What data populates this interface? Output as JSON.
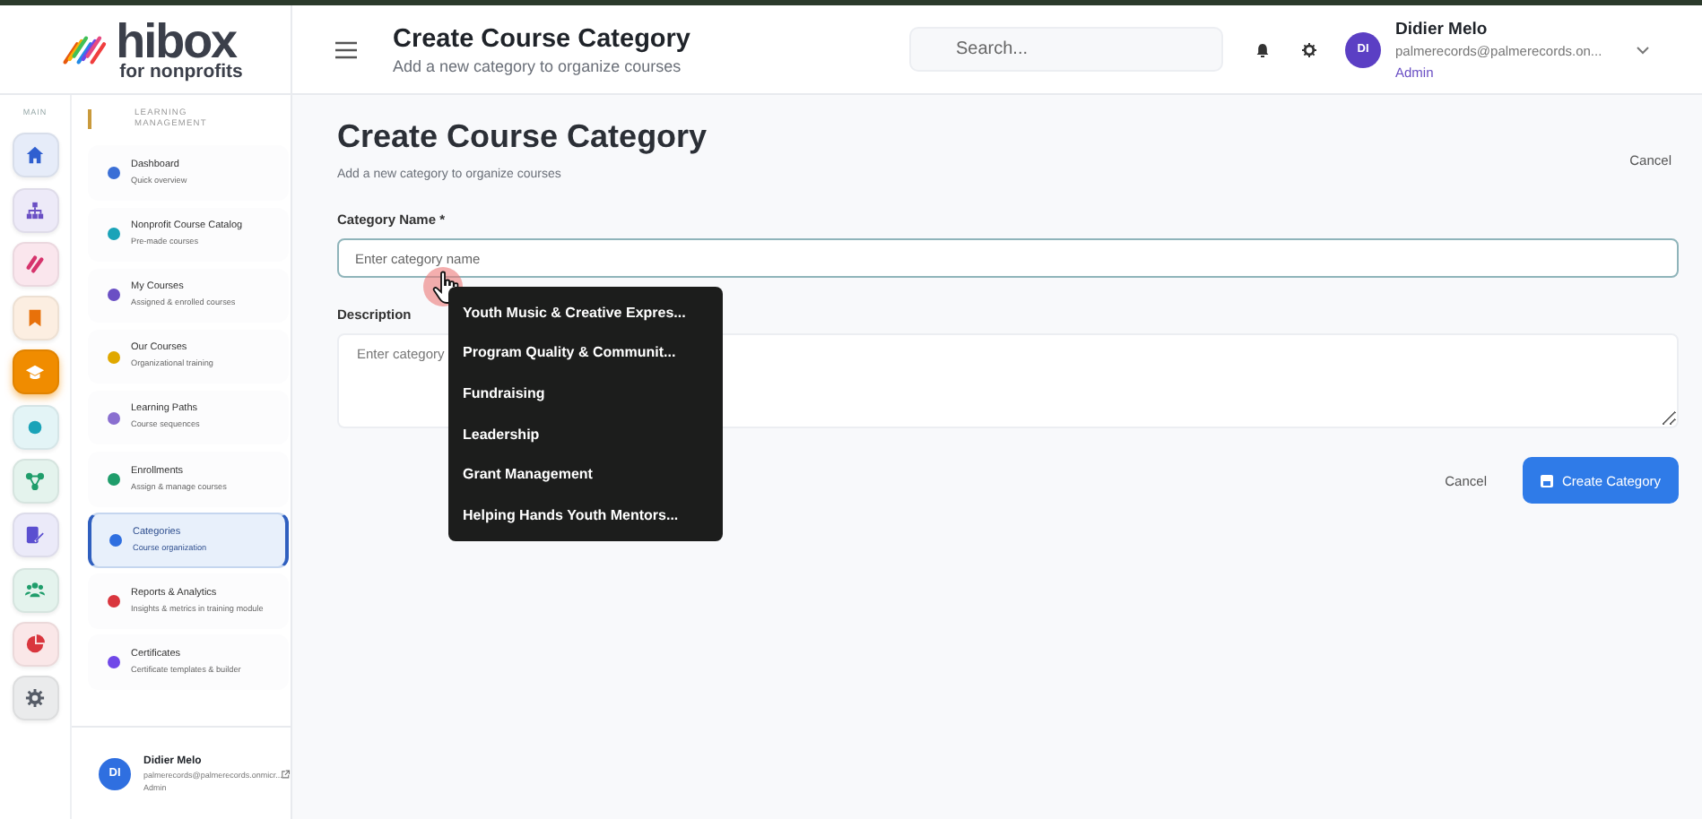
{
  "logo": {
    "name": "hibox",
    "tagline": "for nonprofits"
  },
  "header": {
    "title": "Create Course Category",
    "subtitle": "Add a new category to organize courses",
    "search": {
      "placeholder": "Search..."
    },
    "user": {
      "avatar": "DI",
      "name": "Didier Melo",
      "email": "palmerecords@palmerecords.on...",
      "role": "Admin"
    }
  },
  "rail": {
    "label": "MAIN",
    "items": [
      {
        "kind": "home",
        "color": "#2f5fd0",
        "selected": false
      },
      {
        "kind": "sitemap",
        "color": "#6a4fc4",
        "selected": false
      },
      {
        "kind": "link",
        "color": "#d6336c",
        "selected": false
      },
      {
        "kind": "bookmark",
        "color": "#e8710a",
        "selected": false
      },
      {
        "kind": "cap",
        "color": "#f08c00",
        "selected": true
      },
      {
        "kind": "dot",
        "color": "#1aa3b8",
        "selected": false
      },
      {
        "kind": "share",
        "color": "#1f9d6b",
        "selected": false
      },
      {
        "kind": "edit",
        "color": "#5b4fd0",
        "selected": false
      },
      {
        "kind": "people",
        "color": "#1f9d6b",
        "selected": false
      },
      {
        "kind": "pie",
        "color": "#d9363e",
        "selected": false
      },
      {
        "kind": "gear",
        "color": "#555b66",
        "selected": false
      }
    ]
  },
  "nav": {
    "heading": "LEARNING MANAGEMENT",
    "items": [
      {
        "title": "Dashboard",
        "subtitle": "Quick overview",
        "color": "#3b6fd6",
        "selected": false
      },
      {
        "title": "Nonprofit Course Catalog",
        "subtitle": "Pre-made courses",
        "color": "#1aa3b8",
        "selected": false
      },
      {
        "title": "My Courses",
        "subtitle": "Assigned & enrolled courses",
        "color": "#6a4fc4",
        "selected": false
      },
      {
        "title": "Our Courses",
        "subtitle": "Organizational training",
        "color": "#e0a800",
        "selected": false
      },
      {
        "title": "Learning Paths",
        "subtitle": "Course sequences",
        "color": "#8a6fd0",
        "selected": false
      },
      {
        "title": "Enrollments",
        "subtitle": "Assign & manage courses",
        "color": "#1f9d6b",
        "selected": false
      },
      {
        "title": "Categories",
        "subtitle": "Course organization",
        "color": "#2f6fe0",
        "selected": true
      },
      {
        "title": "Reports & Analytics",
        "subtitle": "Insights & metrics in training module",
        "color": "#d9363e",
        "selected": false
      },
      {
        "title": "Certificates",
        "subtitle": "Certificate templates & builder",
        "color": "#7048e8",
        "selected": false
      }
    ]
  },
  "profile": {
    "avatar": "DI",
    "name": "Didier Melo",
    "email": "palmerecords@palmerecords.onmicr...",
    "role": "Admin"
  },
  "page": {
    "title": "Create Course Category",
    "subtitle": "Add a new category to organize courses",
    "cancel": "Cancel",
    "fields": [
      {
        "label": "Category Name *",
        "placeholder": "Enter category name"
      },
      {
        "label": "Description",
        "placeholder": "Enter category"
      }
    ],
    "buttons": [
      "Cancel",
      "Create Category"
    ]
  },
  "suggestions": [
    "Youth Music & Creative Expres...",
    "Program Quality & Communit...",
    "Fundraising",
    "Leadership",
    "Grant Management",
    "Helping Hands Youth Mentors..."
  ]
}
